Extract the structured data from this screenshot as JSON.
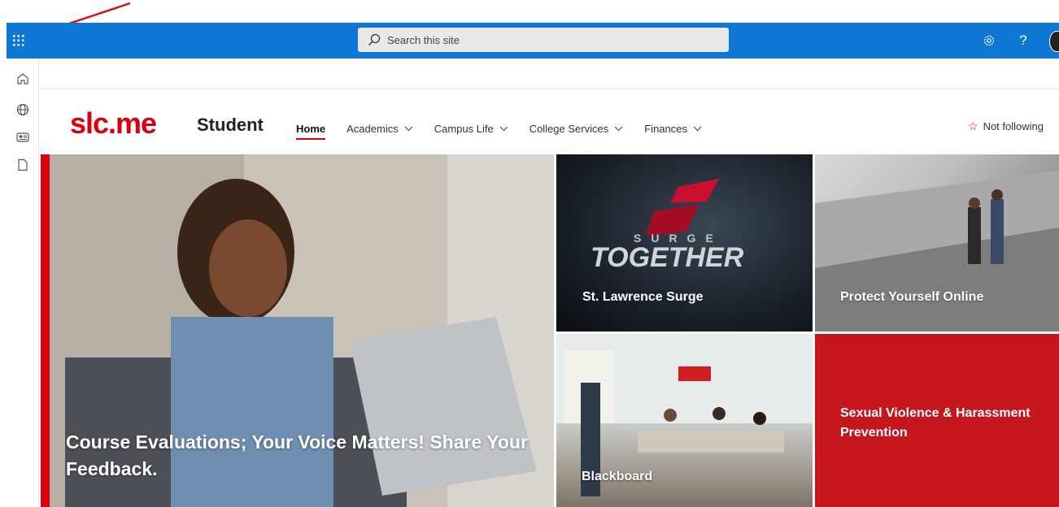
{
  "suitebar": {
    "search_placeholder": "Search this site",
    "bg_color": "#0f78d4"
  },
  "rail": {
    "items": [
      {
        "icon": "home-icon"
      },
      {
        "icon": "globe-icon"
      },
      {
        "icon": "news-icon"
      },
      {
        "icon": "file-icon"
      }
    ]
  },
  "header": {
    "logo": "slc.me",
    "site_title": "Student",
    "nav": [
      {
        "label": "Home",
        "active": true,
        "dropdown": false
      },
      {
        "label": "Academics",
        "active": false,
        "dropdown": true
      },
      {
        "label": "Campus Life",
        "active": false,
        "dropdown": true
      },
      {
        "label": "College Services",
        "active": false,
        "dropdown": true
      },
      {
        "label": "Finances",
        "active": false,
        "dropdown": true
      }
    ],
    "follow_label": "Not following",
    "accent_color": "#d80010"
  },
  "hero": {
    "main": "Course Evaluations; Your Voice Matters! Share Your Feedback.",
    "tiles": [
      {
        "label": "St. Lawrence Surge",
        "image_text_top": "SURGE",
        "image_text_bottom": "TOGETHER"
      },
      {
        "label": "Protect Yourself Online"
      },
      {
        "label": "Blackboard"
      },
      {
        "label": "Sexual Violence & Harassment Prevention"
      }
    ]
  }
}
